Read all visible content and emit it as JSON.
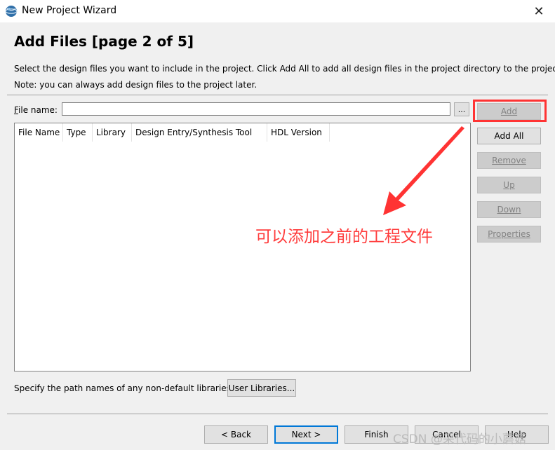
{
  "window": {
    "title": "New Project Wizard",
    "app_icon": "quartus-globe-icon",
    "close_glyph": "✕"
  },
  "page": {
    "title": "Add Files [page 2 of 5]",
    "description_line1": "Select the design files you want to include in the project. Click Add All to add all design files in the project directory to the project.",
    "description_line2": "Note: you can always add design files to the project later."
  },
  "file_name": {
    "label": "File name:",
    "value": "",
    "browse_label": "..."
  },
  "table": {
    "columns": [
      "File Name",
      "Type",
      "Library",
      "Design Entry/Synthesis Tool",
      "HDL Version"
    ],
    "rows": []
  },
  "side_buttons": {
    "add": "Add",
    "add_all": "Add All",
    "remove": "Remove",
    "up": "Up",
    "down": "Down",
    "properties": "Properties"
  },
  "annotation": {
    "text": "可以添加之前的工程文件",
    "color": "#ff3c3c"
  },
  "libraries": {
    "text": "Specify the path names of any non-default libraries.",
    "button": "User Libraries..."
  },
  "footer": {
    "back": "< Back",
    "next": "Next >",
    "finish": "Finish",
    "cancel": "Cancel",
    "help": "Help"
  },
  "watermark": "CSDN @采代码的小蘑菇"
}
